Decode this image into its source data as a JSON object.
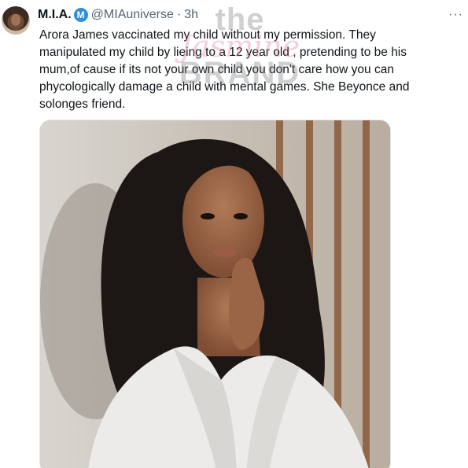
{
  "tweet": {
    "display_name": "M.I.A.",
    "verified_icon": "verified-badge-icon",
    "handle": "@MIAuniverse",
    "separator": "·",
    "time": "3h",
    "more": "···",
    "text": "Arora James vaccinated my child without my permission. They manipulated my child by lieing to a 12 year old , pretending to be his mum,of cause if its not your own child you don't care how you can phycologically damage a child with mental games. She Beyonce and solonges friend."
  },
  "watermark": {
    "line1": "the",
    "line2": "Jasmine",
    "line3": "BRAND"
  },
  "media": {
    "description_icon": "photo-portrait-image"
  }
}
